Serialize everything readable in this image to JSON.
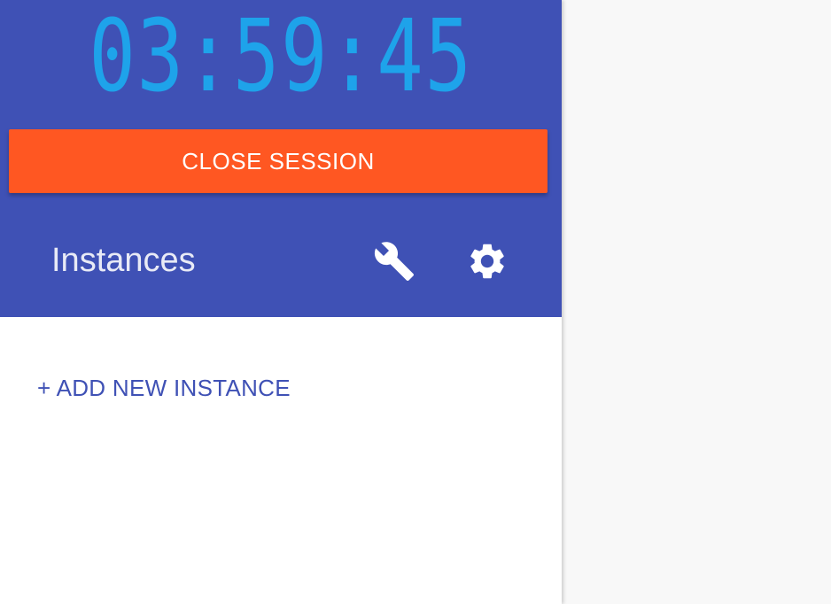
{
  "session": {
    "timer": "03:59:45",
    "close_label": "CLOSE SESSION"
  },
  "instances": {
    "title": "Instances",
    "settings_icon": "wrench-icon",
    "config_icon": "gear-icon",
    "add_label": "+ ADD NEW INSTANCE"
  },
  "colors": {
    "header_bg": "#3f51b5",
    "timer": "#1ea3ea",
    "close_button": "#ff5722",
    "accent_link": "#3f51b5",
    "main_bg": "#f8f8f8"
  }
}
